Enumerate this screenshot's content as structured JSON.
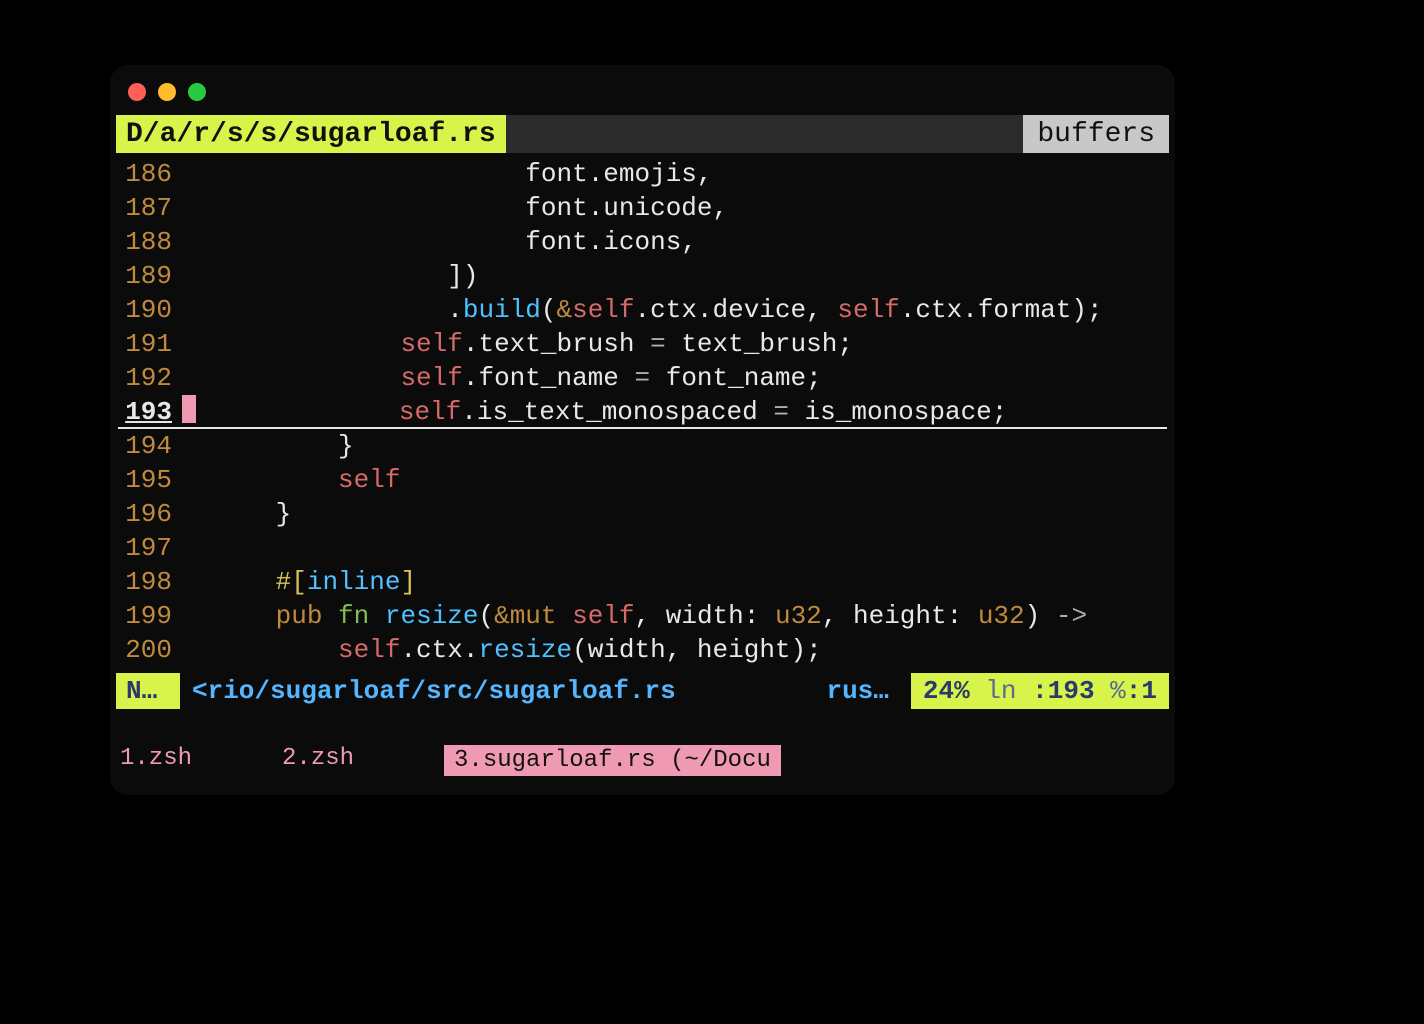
{
  "colors": {
    "accent_yellow": "#d8f34a",
    "accent_pink": "#ef9ab2",
    "traffic_red": "#ff5f56",
    "traffic_yellow": "#ffbd2e",
    "traffic_green": "#27c93f"
  },
  "titlebar": {
    "path": "D/a/r/s/s/sugarloaf.rs",
    "right_label": "buffers"
  },
  "editor": {
    "current_line": 193,
    "lines": [
      {
        "n": 186,
        "segments": [
          {
            "indent": 22
          },
          {
            "t": "font",
            "c": "white"
          },
          {
            "t": ".emojis,",
            "c": "white"
          }
        ]
      },
      {
        "n": 187,
        "segments": [
          {
            "indent": 22
          },
          {
            "t": "font",
            "c": "white"
          },
          {
            "t": ".unicode,",
            "c": "white"
          }
        ]
      },
      {
        "n": 188,
        "segments": [
          {
            "indent": 22
          },
          {
            "t": "font",
            "c": "white"
          },
          {
            "t": ".icons,",
            "c": "white"
          }
        ]
      },
      {
        "n": 189,
        "segments": [
          {
            "indent": 17
          },
          {
            "t": "])",
            "c": "white"
          }
        ]
      },
      {
        "n": 190,
        "segments": [
          {
            "indent": 17
          },
          {
            "t": ".",
            "c": "white"
          },
          {
            "t": "build",
            "c": "cyan"
          },
          {
            "t": "(",
            "c": "white"
          },
          {
            "t": "&",
            "c": "orange"
          },
          {
            "t": "self",
            "c": "red"
          },
          {
            "t": ".ctx.device, ",
            "c": "white"
          },
          {
            "t": "self",
            "c": "red"
          },
          {
            "t": ".ctx.format);",
            "c": "white"
          }
        ]
      },
      {
        "n": 191,
        "segments": [
          {
            "indent": 14
          },
          {
            "t": "self",
            "c": "red"
          },
          {
            "t": ".text_brush ",
            "c": "white"
          },
          {
            "t": "=",
            "c": "grey"
          },
          {
            "t": " text_brush;",
            "c": "white"
          }
        ]
      },
      {
        "n": 192,
        "segments": [
          {
            "indent": 14
          },
          {
            "t": "self",
            "c": "red"
          },
          {
            "t": ".font_name ",
            "c": "white"
          },
          {
            "t": "=",
            "c": "grey"
          },
          {
            "t": " font_name;",
            "c": "white"
          }
        ]
      },
      {
        "n": 193,
        "segments": [
          {
            "indent": 14
          },
          {
            "t": "self",
            "c": "red"
          },
          {
            "t": ".is_text_monospaced ",
            "c": "white"
          },
          {
            "t": "=",
            "c": "grey"
          },
          {
            "t": " is_monospace;",
            "c": "white"
          }
        ]
      },
      {
        "n": 194,
        "segments": [
          {
            "indent": 10
          },
          {
            "t": "}",
            "c": "white"
          }
        ]
      },
      {
        "n": 195,
        "segments": [
          {
            "indent": 10
          },
          {
            "t": "self",
            "c": "red"
          }
        ]
      },
      {
        "n": 196,
        "segments": [
          {
            "indent": 6
          },
          {
            "t": "}",
            "c": "white"
          }
        ]
      },
      {
        "n": 197,
        "segments": []
      },
      {
        "n": 198,
        "segments": [
          {
            "indent": 6
          },
          {
            "t": "#[",
            "c": "yellow"
          },
          {
            "t": "inline",
            "c": "cyan"
          },
          {
            "t": "]",
            "c": "yellow"
          }
        ]
      },
      {
        "n": 199,
        "segments": [
          {
            "indent": 6
          },
          {
            "t": "pub ",
            "c": "orange"
          },
          {
            "t": "fn ",
            "c": "green"
          },
          {
            "t": "resize",
            "c": "cyan"
          },
          {
            "t": "(",
            "c": "white"
          },
          {
            "t": "&mut ",
            "c": "orange"
          },
          {
            "t": "self",
            "c": "red"
          },
          {
            "t": ", width: ",
            "c": "white"
          },
          {
            "t": "u32",
            "c": "orange"
          },
          {
            "t": ", height: ",
            "c": "white"
          },
          {
            "t": "u32",
            "c": "orange"
          },
          {
            "t": ") ",
            "c": "white"
          },
          {
            "t": "->",
            "c": "grey"
          }
        ]
      },
      {
        "n": 200,
        "segments": [
          {
            "indent": 10
          },
          {
            "t": "self",
            "c": "red"
          },
          {
            "t": ".ctx.",
            "c": "white"
          },
          {
            "t": "resize",
            "c": "cyan"
          },
          {
            "t": "(width, height);",
            "c": "white"
          }
        ]
      }
    ]
  },
  "statusbar": {
    "mode": "N…",
    "file_path": "<rio/sugarloaf/src/sugarloaf.rs",
    "lang": "rus…",
    "percent": "24%",
    "ln_label": "ln",
    "ln_value": ":193",
    "col_label": "%",
    "col_value": ":1"
  },
  "tabs": [
    {
      "label": "1.zsh",
      "active": false
    },
    {
      "label": "2.zsh",
      "active": false
    },
    {
      "label": "3.sugarloaf.rs (~/Docu",
      "active": true
    }
  ]
}
